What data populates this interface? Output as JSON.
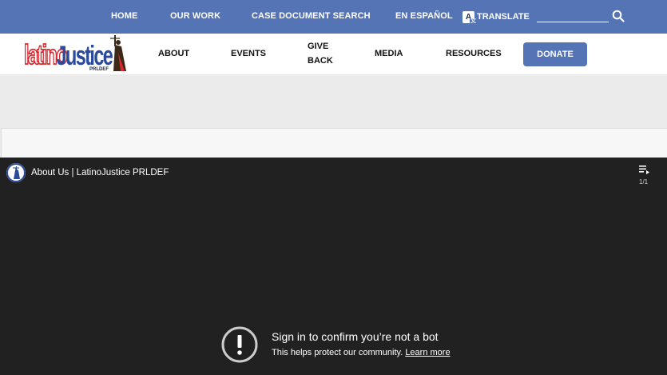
{
  "top_nav": {
    "items": [
      "HOME",
      "OUR WORK",
      "CASE DOCUMENT SEARCH",
      "EN ESPAÑOL"
    ],
    "translate_label": "TRANSLATE",
    "translate_icon": "A",
    "search_placeholder": "",
    "search_icon": "search-icon"
  },
  "main_nav": {
    "logo": {
      "text_latino": "latino",
      "text_justice": "Justice",
      "text_prldef": "PRLDEF"
    },
    "items": [
      "ABOUT",
      "EVENTS",
      "GIVE",
      "BACK",
      "MEDIA",
      "RESOURCES"
    ],
    "donate_label": "DONATE"
  },
  "video": {
    "title": "About Us | LatinoJustice PRLDEF",
    "playlist_count": "1/1",
    "message_title": "Sign in to confirm you’re not a bot",
    "message_body": "This helps protect our community.",
    "learn_more": "Learn more"
  },
  "colors": {
    "top_bar": "#5574b6",
    "logo_red": "#d9272e",
    "logo_blue": "#2b4a9b",
    "video_bg": "#212121"
  }
}
